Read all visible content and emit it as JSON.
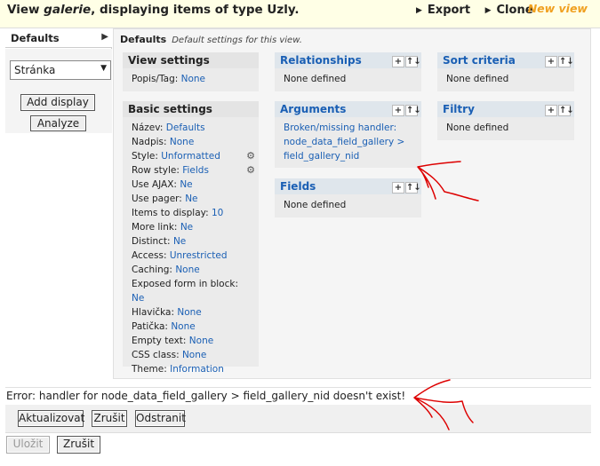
{
  "header": {
    "title_prefix": "View ",
    "title_view": "galerie",
    "title_suffix": ", displaying items of type Uzly.",
    "export": "Export",
    "clone": "Clone",
    "new_view": "New view"
  },
  "left": {
    "tab": "Defaults",
    "display_select": "Stránka",
    "add_display": "Add display",
    "analyze": "Analyze"
  },
  "main": {
    "defaults_title": "Defaults",
    "defaults_desc": "Default settings for this view.",
    "view_settings": {
      "title": "View settings",
      "rows": [
        {
          "label": "Popis/Tag: ",
          "value": "None"
        }
      ]
    },
    "basic_settings": {
      "title": "Basic settings",
      "rows": [
        {
          "label": "Název: ",
          "value": "Defaults"
        },
        {
          "label": "Nadpis: ",
          "value": "None"
        },
        {
          "label": "Style: ",
          "value": "Unformatted"
        },
        {
          "label": "Row style: ",
          "value": "Fields"
        },
        {
          "label": "Use AJAX: ",
          "value": "Ne"
        },
        {
          "label": "Use pager: ",
          "value": "Ne"
        },
        {
          "label": "Items to display: ",
          "value": "10"
        },
        {
          "label": "More link: ",
          "value": "Ne"
        },
        {
          "label": "Distinct: ",
          "value": "Ne"
        },
        {
          "label": "Access: ",
          "value": "Unrestricted"
        },
        {
          "label": "Caching: ",
          "value": "None"
        },
        {
          "label": "Exposed form in block: ",
          "value": "Ne"
        },
        {
          "label": "Hlavička: ",
          "value": "None"
        },
        {
          "label": "Patička: ",
          "value": "None"
        },
        {
          "label": "Empty text: ",
          "value": "None"
        },
        {
          "label": "CSS class: ",
          "value": "None"
        },
        {
          "label": "Theme: ",
          "value": "Information"
        }
      ]
    },
    "relationships": {
      "title": "Relationships",
      "body": "None defined"
    },
    "arguments": {
      "title": "Arguments",
      "lines": [
        "Broken/missing handler:",
        "node_data_field_gallery >",
        "field_gallery_nid"
      ]
    },
    "fields": {
      "title": "Fields",
      "body": "None defined"
    },
    "sort_criteria": {
      "title": "Sort criteria",
      "body": "None defined"
    },
    "filtry": {
      "title": "Filtry",
      "body": "None defined"
    },
    "tools": {
      "add": "+",
      "rearrange": "↑↓"
    }
  },
  "error": "Error: handler for node_data_field_gallery > field_gallery_nid doesn't exist!",
  "buttons": {
    "update": "Aktualizovat",
    "cancel": "Zrušit",
    "remove": "Odstranit",
    "save": "Uložit",
    "cancel2": "Zrušit"
  },
  "colors": {
    "link": "#1a5fb4",
    "annotation": "#dd0000",
    "new_view": "#f0a020"
  }
}
